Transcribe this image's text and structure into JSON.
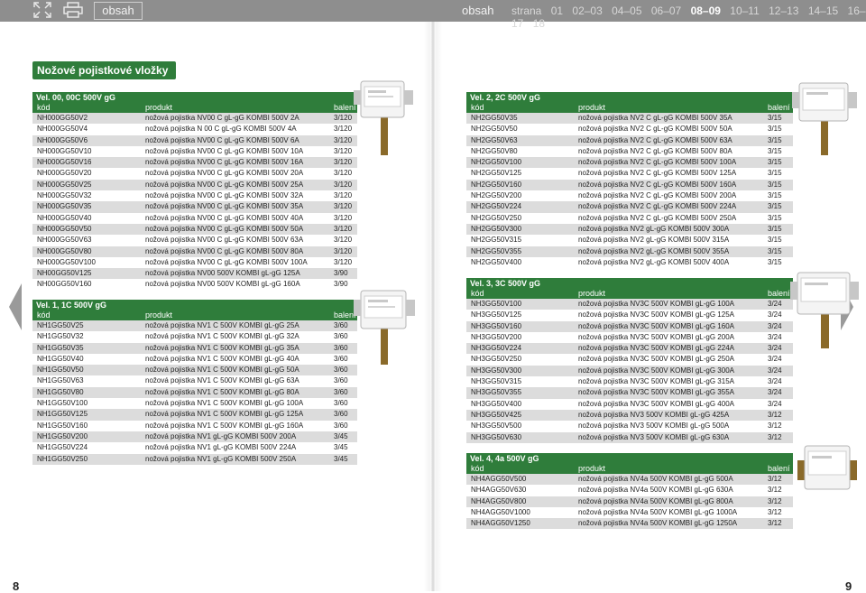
{
  "topbar": {
    "obsah_button": "obsah",
    "obsah_label": "obsah",
    "strana_label": "strana",
    "pages": [
      "01",
      "02–03",
      "04–05",
      "06–07",
      "08–09",
      "10–11",
      "12–13",
      "14–15",
      "16–17",
      "18"
    ],
    "current_page": "08–09"
  },
  "page_title": "Nožové pojistkové vložky gG",
  "page_left_number": "8",
  "page_right_number": "9",
  "columns": {
    "kod": "kód",
    "produkt": "produkt",
    "baleni": "balení"
  },
  "tables": [
    {
      "title": "Vel. 00, 00C 500V gG",
      "rows": [
        [
          "NH000GG50V2",
          "nožová pojistka NV00 C gL-gG KOMBI 500V 2A",
          "3/120"
        ],
        [
          "NH000GG50V4",
          "nožová pojistka N 00 C gL-gG KOMBI 500V 4A",
          "3/120"
        ],
        [
          "NH000GG50V6",
          "nožová pojistka NV00 C gL-gG KOMBI 500V 6A",
          "3/120"
        ],
        [
          "NH000GG50V10",
          "nožová pojistka NV00 C gL-gG KOMBI 500V 10A",
          "3/120"
        ],
        [
          "NH000GG50V16",
          "nožová pojistka NV00 C gL-gG KOMBI 500V 16A",
          "3/120"
        ],
        [
          "NH000GG50V20",
          "nožová pojistka NV00 C gL-gG KOMBI 500V 20A",
          "3/120"
        ],
        [
          "NH000GG50V25",
          "nožová pojistka NV00 C gL-gG KOMBI 500V 25A",
          "3/120"
        ],
        [
          "NH000GG50V32",
          "nožová pojistka NV00 C gL-gG KOMBI 500V 32A",
          "3/120"
        ],
        [
          "NH000GG50V35",
          "nožová pojistka NV00 C gL-gG KOMBI 500V 35A",
          "3/120"
        ],
        [
          "NH000GG50V40",
          "nožová pojistka NV00 C gL-gG KOMBI 500V 40A",
          "3/120"
        ],
        [
          "NH000GG50V50",
          "nožová pojistka NV00 C gL-gG KOMBI 500V 50A",
          "3/120"
        ],
        [
          "NH000GG50V63",
          "nožová pojistka NV00 C gL-gG KOMBI 500V 63A",
          "3/120"
        ],
        [
          "NH000GG50V80",
          "nožová pojistka NV00 C gL-gG KOMBI 500V 80A",
          "3/120"
        ],
        [
          "NH000GG50V100",
          "nožová pojistka NV00 C gL-gG KOMBI 500V 100A",
          "3/120"
        ],
        [
          "NH00GG50V125",
          "nožová pojistka NV00 500V KOMBI gL-gG 125A",
          "3/90"
        ],
        [
          "NH00GG50V160",
          "nožová pojistka NV00 500V KOMBI gL-gG 160A",
          "3/90"
        ]
      ]
    },
    {
      "title": "Vel. 1, 1C 500V gG",
      "rows": [
        [
          "NH1GG50V25",
          "nožová pojistka NV1 C 500V KOMBI gL-gG 25A",
          "3/60"
        ],
        [
          "NH1GG50V32",
          "nožová pojistka NV1 C 500V KOMBI gL-gG 32A",
          "3/60"
        ],
        [
          "NH1GG50V35",
          "nožová pojistka NV1 C 500V KOMBI gL-gG 35A",
          "3/60"
        ],
        [
          "NH1GG50V40",
          "nožová pojistka NV1 C 500V KOMBI gL-gG 40A",
          "3/60"
        ],
        [
          "NH1GG50V50",
          "nožová pojistka NV1 C 500V KOMBI gL-gG 50A",
          "3/60"
        ],
        [
          "NH1GG50V63",
          "nožová pojistka NV1 C 500V KOMBI gL-gG 63A",
          "3/60"
        ],
        [
          "NH1GG50V80",
          "nožová pojistka NV1 C 500V KOMBI gL-gG 80A",
          "3/60"
        ],
        [
          "NH1GG50V100",
          "nožová pojistka NV1 C 500V KOMBI gL-gG 100A",
          "3/60"
        ],
        [
          "NH1GG50V125",
          "nožová pojistka NV1 C 500V KOMBI gL-gG 125A",
          "3/60"
        ],
        [
          "NH1GG50V160",
          "nožová pojistka NV1 C 500V KOMBI gL-gG 160A",
          "3/60"
        ],
        [
          "NH1GG50V200",
          "nožová pojistka NV1 gL-gG KOMBI 500V 200A",
          "3/45"
        ],
        [
          "NH1GG50V224",
          "nožová pojistka NV1 gL-gG KOMBI 500V 224A",
          "3/45"
        ],
        [
          "NH1GG50V250",
          "nožová pojistka NV1 gL-gG KOMBI 500V 250A",
          "3/45"
        ]
      ]
    },
    {
      "title": "Vel. 2, 2C 500V gG",
      "rows": [
        [
          "NH2GG50V35",
          "nožová pojistka NV2 C gL-gG KOMBI 500V 35A",
          "3/15"
        ],
        [
          "NH2GG50V50",
          "nožová pojistka NV2 C gL-gG KOMBI 500V 50A",
          "3/15"
        ],
        [
          "NH2GG50V63",
          "nožová pojistka NV2 C gL-gG KOMBI 500V 63A",
          "3/15"
        ],
        [
          "NH2GG50V80",
          "nožová pojistka NV2 C gL-gG KOMBI 500V 80A",
          "3/15"
        ],
        [
          "NH2GG50V100",
          "nožová pojistka NV2 C gL-gG KOMBI 500V 100A",
          "3/15"
        ],
        [
          "NH2GG50V125",
          "nožová pojistka NV2 C gL-gG KOMBI 500V 125A",
          "3/15"
        ],
        [
          "NH2GG50V160",
          "nožová pojistka NV2 C gL-gG KOMBI 500V 160A",
          "3/15"
        ],
        [
          "NH2GG50V200",
          "nožová pojistka NV2 C gL-gG KOMBI 500V 200A",
          "3/15"
        ],
        [
          "NH2GG50V224",
          "nožová pojistka NV2 C gL-gG KOMBI 500V 224A",
          "3/15"
        ],
        [
          "NH2GG50V250",
          "nožová pojistka NV2 C gL-gG KOMBI 500V 250A",
          "3/15"
        ],
        [
          "NH2GG50V300",
          "nožová pojistka NV2 gL-gG KOMBI 500V 300A",
          "3/15"
        ],
        [
          "NH2GG50V315",
          "nožová pojistka NV2 gL-gG KOMBI 500V 315A",
          "3/15"
        ],
        [
          "NH2GG50V355",
          "nožová pojistka NV2 gL-gG KOMBI 500V 355A",
          "3/15"
        ],
        [
          "NH2GG50V400",
          "nožová pojistka NV2 gL-gG KOMBI 500V 400A",
          "3/15"
        ]
      ]
    },
    {
      "title": "Vel. 3, 3C 500V gG",
      "rows": [
        [
          "NH3GG50V100",
          "nožová pojistka NV3C 500V KOMBI gL-gG 100A",
          "3/24"
        ],
        [
          "NH3GG50V125",
          "nožová pojistka NV3C 500V KOMBI gL-gG 125A",
          "3/24"
        ],
        [
          "NH3GG50V160",
          "nožová pojistka NV3C 500V KOMBI gL-gG 160A",
          "3/24"
        ],
        [
          "NH3GG50V200",
          "nožová pojistka NV3C 500V KOMBI gL-gG 200A",
          "3/24"
        ],
        [
          "NH3GG50V224",
          "nožová pojistka NV3C 500V KOMBI gL-gG 224A",
          "3/24"
        ],
        [
          "NH3GG50V250",
          "nožová pojistka NV3C 500V KOMBI gL-gG 250A",
          "3/24"
        ],
        [
          "NH3GG50V300",
          "nožová pojistka NV3C 500V KOMBI gL-gG 300A",
          "3/24"
        ],
        [
          "NH3GG50V315",
          "nožová pojistka NV3C 500V KOMBI gL-gG 315A",
          "3/24"
        ],
        [
          "NH3GG50V355",
          "nožová pojistka NV3C 500V KOMBI gL-gG 355A",
          "3/24"
        ],
        [
          "NH3GG50V400",
          "nožová pojistka NV3C 500V KOMBI gL-gG 400A",
          "3/24"
        ],
        [
          "NH3GG50V425",
          "nožová pojistka NV3 500V KOMBI gL-gG 425A",
          "3/12"
        ],
        [
          "NH3GG50V500",
          "nožová pojistka NV3 500V KOMBI gL-gG 500A",
          "3/12"
        ],
        [
          "NH3GG50V630",
          "nožová pojistka NV3 500V KOMBI gL-gG 630A",
          "3/12"
        ]
      ]
    },
    {
      "title": "Vel. 4, 4a 500V gG",
      "rows": [
        [
          "NH4AGG50V500",
          "nožová pojistka NV4a 500V KOMBI gL-gG 500A",
          "3/12"
        ],
        [
          "NH4AGG50V630",
          "nožová pojistka NV4a 500V KOMBI gL-gG 630A",
          "3/12"
        ],
        [
          "NH4AGG50V800",
          "nožová pojistka NV4a 500V KOMBI gL-gG 800A",
          "3/12"
        ],
        [
          "NH4AGG50V1000",
          "nožová pojistka NV4a 500V KOMBI gL-gG 1000A",
          "3/12"
        ],
        [
          "NH4AGG50V1250",
          "nožová pojistka NV4a 500V KOMBI gL-gG 1250A",
          "3/12"
        ]
      ]
    }
  ],
  "colors": {
    "accent_green": "#2f7d3b",
    "topbar_gray": "#8e8e8e",
    "row_alt_gray": "#dcdcdc"
  },
  "icons": [
    "fullscreen-icon",
    "print-icon",
    "prev-page-arrow-icon",
    "next-page-arrow-icon",
    "fuse-image"
  ]
}
